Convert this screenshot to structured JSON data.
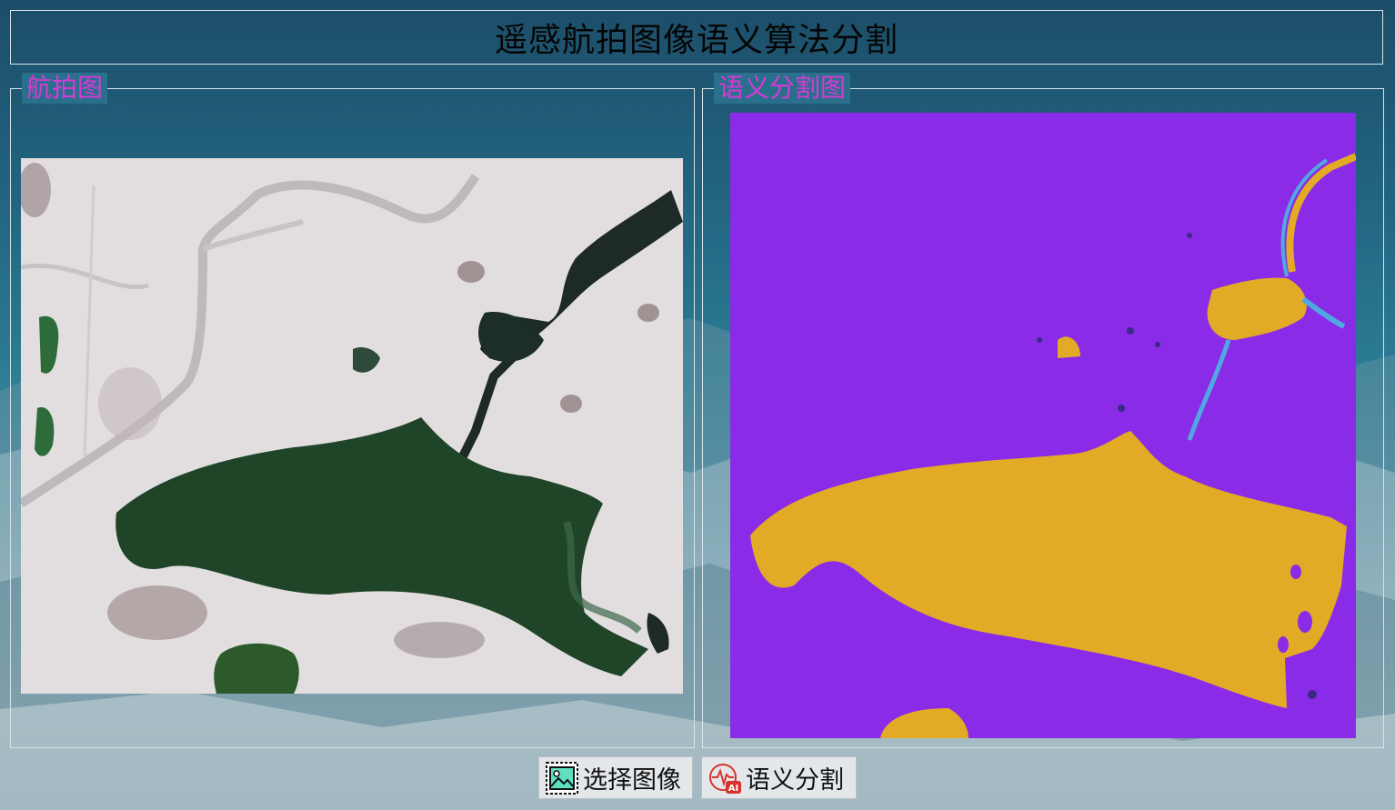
{
  "window": {
    "title": "遥感航拍图像语义算法分割"
  },
  "panels": {
    "aerial": {
      "label": "航拍图"
    },
    "segmentation": {
      "label": "语义分割图"
    }
  },
  "toolbar": {
    "select_image_label": "选择图像",
    "segment_label": "语义分割"
  },
  "icons": {
    "select_image": "image-picture-icon",
    "segment": "ai-waveform-icon"
  },
  "colors": {
    "title_text": "#050505",
    "panel_label": "#d63ad6",
    "segmentation_background": "#8a2be8",
    "segmentation_water": "#e3aa25",
    "segmentation_edge": "#4fa9e0",
    "border": "#d7e4ea"
  }
}
